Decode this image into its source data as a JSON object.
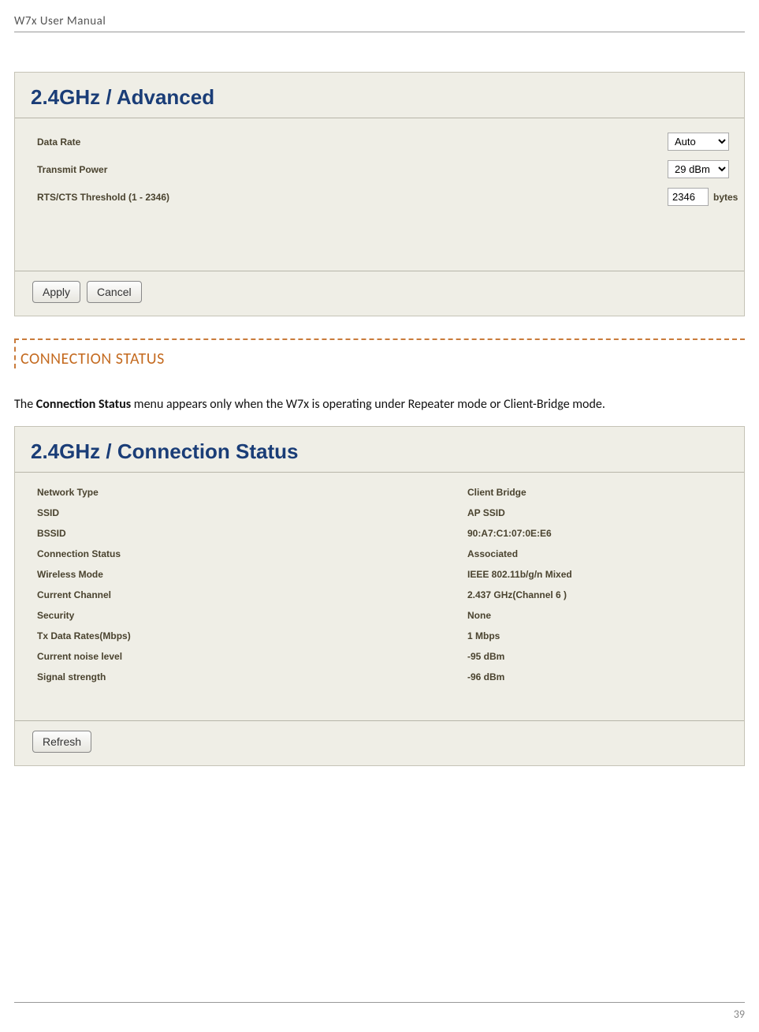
{
  "doc": {
    "header": "W7x User Manual",
    "page_number": "39"
  },
  "advanced_panel": {
    "title": "2.4GHz / Advanced",
    "fields": {
      "data_rate": {
        "label": "Data Rate",
        "value": "Auto"
      },
      "transmit_power": {
        "label": "Transmit Power",
        "value": "29 dBm"
      },
      "rts_cts": {
        "label": "RTS/CTS Threshold (1 - 2346)",
        "value": "2346",
        "unit": "bytes"
      }
    },
    "buttons": {
      "apply": "Apply",
      "cancel": "Cancel"
    }
  },
  "section": {
    "heading": "CONNECTION STATUS",
    "text_prefix": "The ",
    "text_bold": "Connection Status",
    "text_suffix": " menu appears only when the W7x is operating under Repeater mode or Client-Bridge mode."
  },
  "status_panel": {
    "title": "2.4GHz / Connection Status",
    "rows": [
      {
        "label": "Network Type",
        "value": "Client Bridge"
      },
      {
        "label": "SSID",
        "value": "AP SSID"
      },
      {
        "label": "BSSID",
        "value": "90:A7:C1:07:0E:E6"
      },
      {
        "label": "Connection Status",
        "value": "Associated"
      },
      {
        "label": "Wireless Mode",
        "value": "IEEE 802.11b/g/n Mixed"
      },
      {
        "label": "Current Channel",
        "value": "2.437 GHz(Channel 6 )"
      },
      {
        "label": "Security",
        "value": "None"
      },
      {
        "label": "Tx Data Rates(Mbps)",
        "value": "1 Mbps"
      },
      {
        "label": "Current noise level",
        "value": "-95 dBm"
      },
      {
        "label": "Signal strength",
        "value": "-96 dBm"
      }
    ],
    "refresh": "Refresh"
  }
}
